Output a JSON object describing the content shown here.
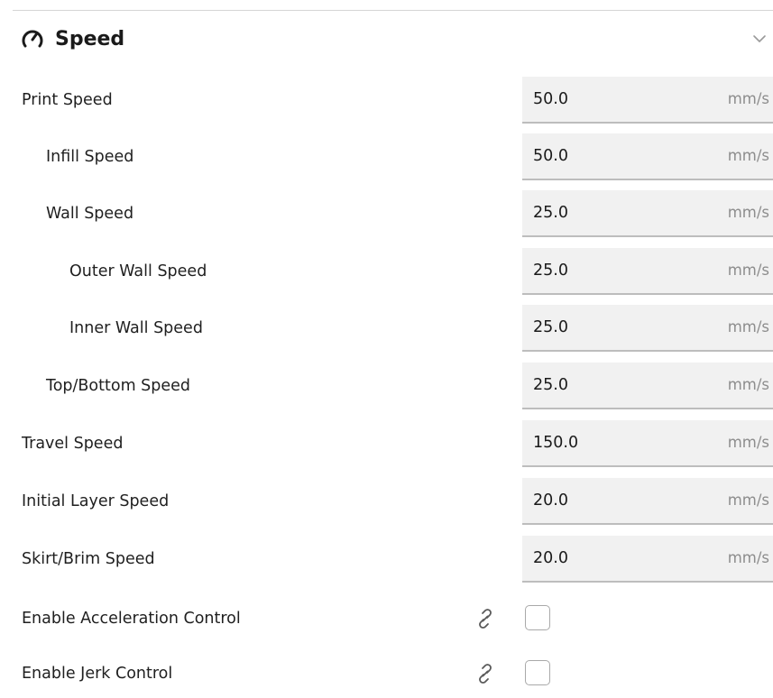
{
  "section": {
    "title": "Speed",
    "icon": "speedometer-icon",
    "toggle_icon": "chevron-down-icon"
  },
  "settings": [
    {
      "label": "Print Speed",
      "value": "50.0",
      "unit": "mm/s"
    },
    {
      "label": "Infill Speed",
      "value": "50.0",
      "unit": "mm/s"
    },
    {
      "label": "Wall Speed",
      "value": "25.0",
      "unit": "mm/s"
    },
    {
      "label": "Outer Wall Speed",
      "value": "25.0",
      "unit": "mm/s"
    },
    {
      "label": "Inner Wall Speed",
      "value": "25.0",
      "unit": "mm/s"
    },
    {
      "label": "Top/Bottom Speed",
      "value": "25.0",
      "unit": "mm/s"
    },
    {
      "label": "Travel Speed",
      "value": "150.0",
      "unit": "mm/s"
    },
    {
      "label": "Initial Layer Speed",
      "value": "20.0",
      "unit": "mm/s"
    },
    {
      "label": "Skirt/Brim Speed",
      "value": "20.0",
      "unit": "mm/s"
    }
  ],
  "toggles": [
    {
      "label": "Enable Acceleration Control",
      "checked": false,
      "icon": "link-icon"
    },
    {
      "label": "Enable Jerk Control",
      "checked": false,
      "icon": "link-icon"
    }
  ],
  "colors": {
    "field_background": "#f1f1f1",
    "field_underline": "#bdbdbd",
    "unit_text": "#8d8d8d",
    "text": "#1f1f1f"
  }
}
